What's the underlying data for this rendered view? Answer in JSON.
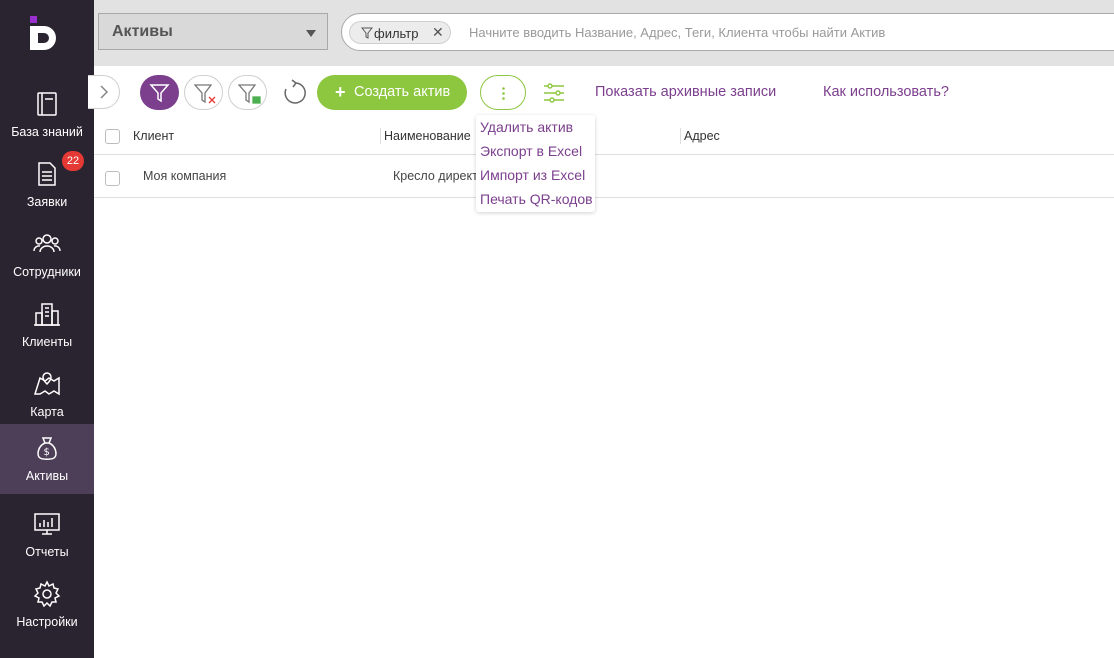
{
  "brand": {
    "logo_icon": "logo-icon",
    "accent": "#7b3f8d",
    "green": "#8dc63f",
    "sidebar_bg": "#2a2330"
  },
  "sidebar": {
    "items": [
      {
        "label": "База знаний",
        "icon": "book-icon"
      },
      {
        "label": "Заявки",
        "icon": "document-icon",
        "badge": "22"
      },
      {
        "label": "Сотрудники",
        "icon": "people-icon"
      },
      {
        "label": "Клиенты",
        "icon": "buildings-icon"
      },
      {
        "label": "Карта",
        "icon": "map-icon"
      },
      {
        "label": "Активы",
        "icon": "money-bag-icon",
        "active": true
      },
      {
        "label": "Отчеты",
        "icon": "chart-monitor-icon"
      },
      {
        "label": "Настройки",
        "icon": "gear-icon"
      }
    ]
  },
  "topbar": {
    "section_select": "Активы",
    "filter_chip": "фильтр",
    "filter_chip_close": "✕",
    "search_placeholder": "Начните вводить Название, Адрес, Теги, Клиента чтобы найти Актив"
  },
  "toolbar": {
    "create_label": "Создать актив",
    "create_plus": "+",
    "show_archive": "Показать архивные записи",
    "how_to_use": "Как использовать?"
  },
  "more_menu": {
    "items": [
      "Удалить актив",
      "Экспорт в Excel",
      "Импорт из Excel",
      "Печать QR-кодов"
    ]
  },
  "table": {
    "columns": [
      "Клиент",
      "Наименование",
      "Адрес"
    ],
    "rows": [
      {
        "client": "Моя компания",
        "name": "Кресло директ",
        "address": ""
      }
    ]
  }
}
